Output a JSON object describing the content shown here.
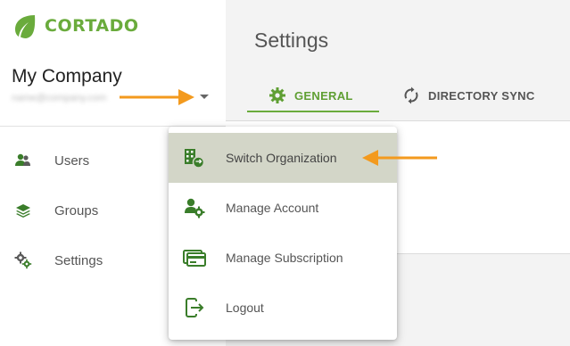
{
  "brand": {
    "name": "CORTADO",
    "color": "#6aab3c"
  },
  "company": {
    "name": "My Company",
    "email": "name@company.com",
    "caret_icon": "caret-down-icon"
  },
  "sidebar": {
    "items": [
      {
        "label": "Users",
        "icon": "users-icon"
      },
      {
        "label": "Groups",
        "icon": "layers-icon"
      },
      {
        "label": "Settings",
        "icon": "gears-icon"
      }
    ]
  },
  "main": {
    "title": "Settings",
    "tabs": [
      {
        "label": "GENERAL",
        "icon": "gear-icon",
        "active": true
      },
      {
        "label": "DIRECTORY SYNC",
        "icon": "sync-icon",
        "active": false
      }
    ]
  },
  "dropdown": {
    "items": [
      {
        "label": "Switch Organization",
        "icon": "switch-organization-icon",
        "highlighted": true
      },
      {
        "label": "Manage Account",
        "icon": "manage-account-icon",
        "highlighted": false
      },
      {
        "label": "Manage Subscription",
        "icon": "credit-card-icon",
        "highlighted": false
      },
      {
        "label": "Logout",
        "icon": "logout-icon",
        "highlighted": false
      }
    ]
  },
  "annotation_color": "#f39a1e"
}
